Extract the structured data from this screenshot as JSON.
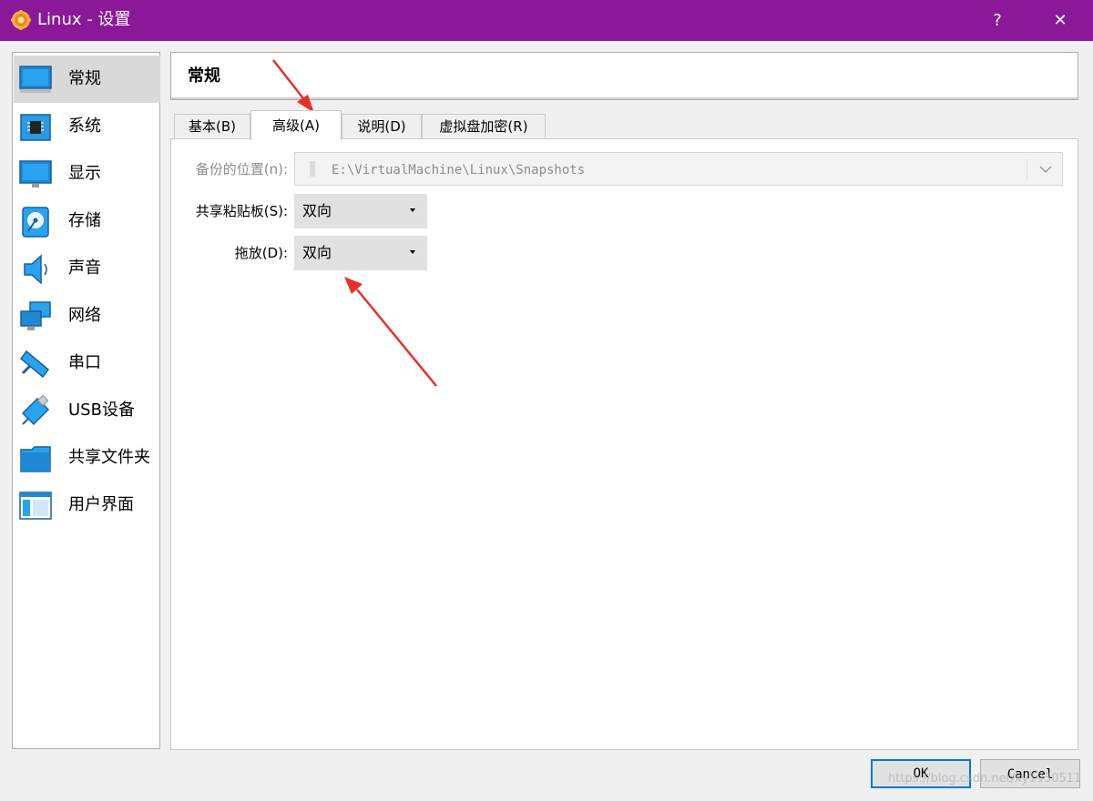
{
  "window": {
    "title": "Linux - 设置",
    "help_label": "?",
    "close_label": "✕",
    "accent": "#8a1898"
  },
  "sidebar": {
    "items": [
      {
        "label": "常规",
        "icon": "monitor-icon"
      },
      {
        "label": "系统",
        "icon": "chip-icon"
      },
      {
        "label": "显示",
        "icon": "display-icon"
      },
      {
        "label": "存储",
        "icon": "disk-icon"
      },
      {
        "label": "声音",
        "icon": "speaker-icon"
      },
      {
        "label": "网络",
        "icon": "network-icon"
      },
      {
        "label": "串口",
        "icon": "serial-port-icon"
      },
      {
        "label": "USB设备",
        "icon": "usb-icon"
      },
      {
        "label": "共享文件夹",
        "icon": "folder-icon"
      },
      {
        "label": "用户界面",
        "icon": "user-interface-icon"
      }
    ],
    "selected_index": 0
  },
  "main": {
    "title": "常规",
    "tabs": [
      {
        "label": "基本(B)"
      },
      {
        "label": "高级(A)"
      },
      {
        "label": "说明(D)"
      },
      {
        "label": "虚拟盘加密(R)"
      }
    ],
    "active_tab": 1,
    "fields": {
      "snapshot_label": "备份的位置(n):",
      "snapshot_path": "E:\\VirtualMachine\\Linux\\Snapshots",
      "clipboard_label": "共享粘贴板(S):",
      "clipboard_value": "双向",
      "dragdrop_label": "拖放(D):",
      "dragdrop_value": "双向"
    }
  },
  "footer": {
    "ok_label": "OK",
    "cancel_label": "Cancel"
  },
  "watermark": "https://blog.csdn.net/xy1930511",
  "colors": {
    "selection": "#d9d9d9",
    "focus": "#0078d7",
    "annotation_arrow": "#e8302a"
  }
}
